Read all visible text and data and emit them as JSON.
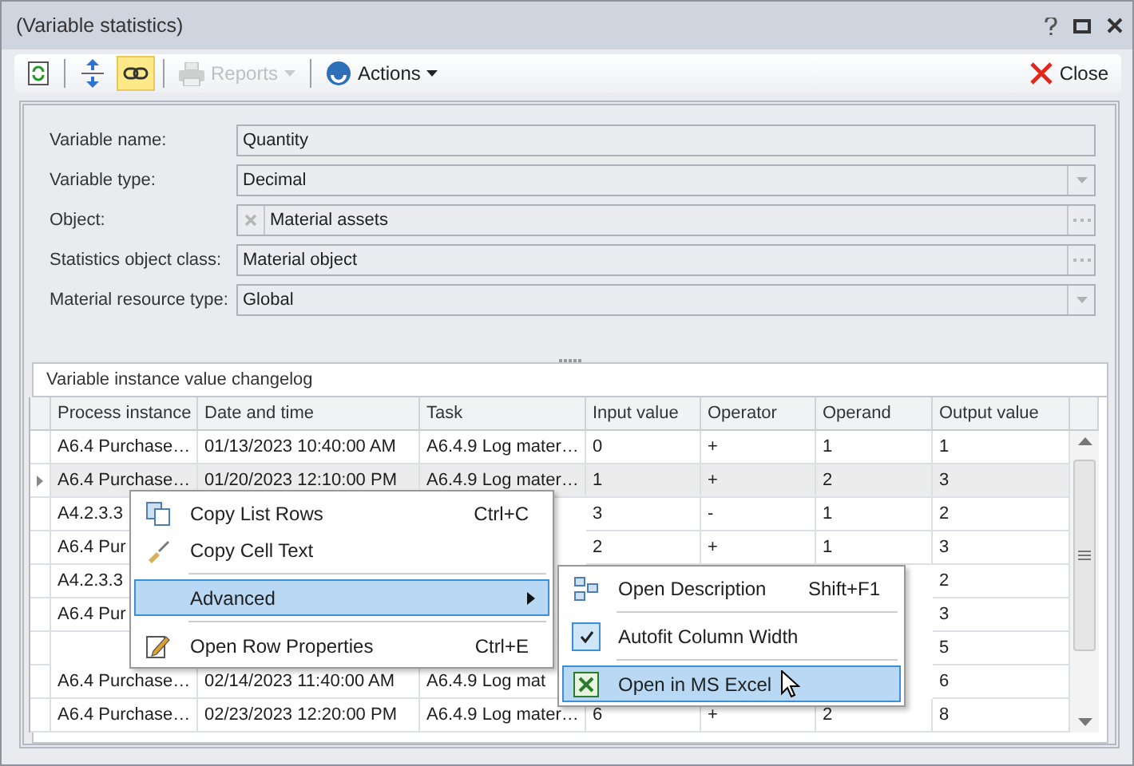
{
  "window": {
    "title": "(Variable statistics)"
  },
  "toolbar": {
    "items": [
      {
        "kind": "refresh",
        "selected": false,
        "disabled": false
      },
      {
        "kind": "expand",
        "selected": false,
        "disabled": false
      },
      {
        "kind": "link",
        "selected": true,
        "disabled": false
      },
      {
        "kind": "reports",
        "label": "Reports",
        "selected": false,
        "disabled": true
      },
      {
        "kind": "actions",
        "label": "Actions",
        "selected": false,
        "disabled": false
      }
    ],
    "close": "Close"
  },
  "form": [
    {
      "label": "Variable name:",
      "value": "Quantity",
      "kind": "text"
    },
    {
      "label": "Variable type:",
      "value": "Decimal",
      "kind": "dropdown"
    },
    {
      "label": "Object:",
      "value": "Material assets",
      "kind": "lookup_clear"
    },
    {
      "label": "Statistics object class:",
      "value": "Material object",
      "kind": "lookup"
    },
    {
      "label": "Material resource type:",
      "value": "Global",
      "kind": "dropdown"
    }
  ],
  "grid": {
    "title": "Variable instance value changelog",
    "columns": [
      "Process instance",
      "Date and time",
      "Task",
      "Input value",
      "Operator",
      "Operand",
      "Output value"
    ],
    "rows": [
      {
        "selected": false,
        "cells": [
          "A6.4 Purchase…",
          "01/13/2023 10:40:00 AM",
          "A6.4.9 Log mater…",
          "0",
          "+",
          "1",
          "1"
        ]
      },
      {
        "selected": true,
        "cells": [
          "A6.4 Purchase…",
          "01/20/2023 12:10:00 PM",
          "A6.4.9 Log mater…",
          "1",
          "+",
          "2",
          "3"
        ]
      },
      {
        "selected": false,
        "cells": [
          "A4.2.3.3",
          null,
          null,
          "3",
          "-",
          "1",
          "2"
        ]
      },
      {
        "selected": false,
        "cells": [
          "A6.4 Pur",
          null,
          null,
          "2",
          "+",
          "1",
          "3"
        ]
      },
      {
        "selected": false,
        "cells": [
          "A4.2.3.3",
          null,
          null,
          null,
          null,
          null,
          "2"
        ]
      },
      {
        "selected": false,
        "cells": [
          "A6.4 Pur",
          null,
          null,
          null,
          null,
          null,
          "3"
        ]
      },
      {
        "selected": false,
        "cells": [
          null,
          null,
          null,
          null,
          null,
          null,
          "5"
        ]
      },
      {
        "selected": false,
        "cells": [
          "A6.4 Purchase…",
          "02/14/2023 11:40:00 AM",
          "A6.4.9 Log mat",
          null,
          null,
          null,
          "6"
        ]
      },
      {
        "selected": false,
        "cells": [
          "A6.4 Purchase…",
          "02/23/2023 12:20:00 PM",
          "A6.4.9 Log mater…",
          "6",
          "+",
          "2",
          "8"
        ]
      }
    ]
  },
  "context_menu": {
    "items": [
      {
        "kind": "copy",
        "label": "Copy List Rows",
        "shortcut": "Ctrl+C",
        "highlighted": false
      },
      {
        "kind": "brush",
        "label": "Copy Cell Text",
        "highlighted": false
      },
      {
        "kind": "separator"
      },
      {
        "kind": "submenu",
        "label": "Advanced",
        "highlighted": true
      },
      {
        "kind": "separator"
      },
      {
        "kind": "edit",
        "label": "Open Row Properties",
        "shortcut": "Ctrl+E",
        "highlighted": false
      }
    ]
  },
  "submenu": {
    "items": [
      {
        "kind": "tree",
        "label": "Open Description",
        "shortcut": "Shift+F1",
        "highlighted": false
      },
      {
        "kind": "separator"
      },
      {
        "kind": "check",
        "label": "Autofit Column Width",
        "checked": true,
        "highlighted": false
      },
      {
        "kind": "separator"
      },
      {
        "kind": "excel",
        "label": "Open in MS Excel",
        "highlighted": true
      }
    ]
  }
}
